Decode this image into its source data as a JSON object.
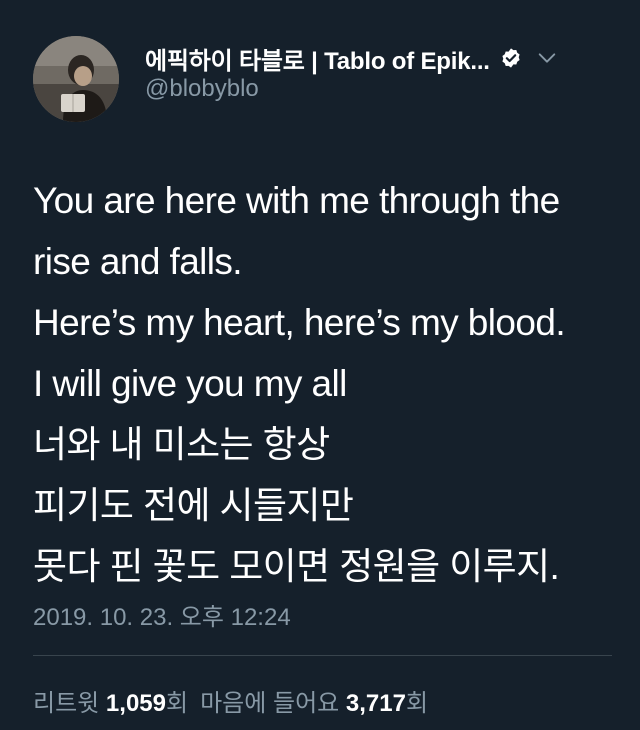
{
  "author": {
    "display_name": "에픽하이 타블로 | Tablo of Epik...",
    "handle": "@blobyblo",
    "verified": true,
    "icons": {
      "verified": "verified-badge-icon",
      "menu": "chevron-down-icon"
    }
  },
  "tweet": {
    "lines": [
      "You are here with me through the",
      "rise and falls.",
      "Here’s my heart, here’s my blood.",
      "I will give you my all",
      "너와 내 미소는 항상",
      "피기도 전에 시들지만",
      "못다 핀 꽃도 모이면 정원을 이루지."
    ],
    "timestamp": "2019. 10. 23. 오후 12:24"
  },
  "stats": {
    "retweets_label": "리트윗",
    "retweets_count": "1,059",
    "retweets_unit": "회",
    "likes_label": "마음에 들어요",
    "likes_count": "3,717",
    "likes_unit": "회"
  },
  "colors": {
    "background": "#15202b",
    "primary_text": "#ffffff",
    "secondary_text": "#8899a6",
    "divider": "#38444d"
  }
}
